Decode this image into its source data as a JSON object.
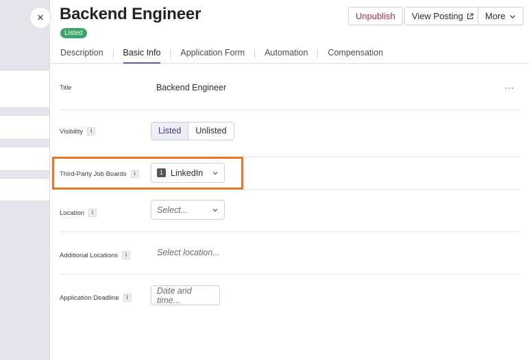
{
  "header": {
    "title": "Backend Engineer",
    "status_badge": "Listed",
    "buttons": {
      "unpublish": "Unpublish",
      "view_posting": "View Posting",
      "more": "More"
    }
  },
  "tabs": [
    {
      "label": "Description"
    },
    {
      "label": "Basic Info"
    },
    {
      "label": "Application Form"
    },
    {
      "label": "Automation"
    },
    {
      "label": "Compensation"
    }
  ],
  "active_tab": "Basic Info",
  "fields": {
    "title": {
      "label": "Title",
      "value": "Backend Engineer"
    },
    "visibility": {
      "label": "Visibility",
      "options": [
        "Listed",
        "Unlisted"
      ],
      "selected": "Listed"
    },
    "job_boards": {
      "label": "Third-Party Job Boards",
      "count": "1",
      "value": "LinkedIn"
    },
    "location": {
      "label": "Location",
      "placeholder": "Select..."
    },
    "additional_locations": {
      "label": "Additional Locations",
      "placeholder": "Select location..."
    },
    "deadline": {
      "label": "Application Deadline",
      "placeholder": "Date and time..."
    }
  },
  "info_glyph": "i",
  "close_glyph": "×",
  "kebab_glyph": "···",
  "colors": {
    "accent": "#5b55b8",
    "listed_badge": "#3aa46a",
    "unpublish": "#a3323d",
    "highlight": "#f07323"
  }
}
